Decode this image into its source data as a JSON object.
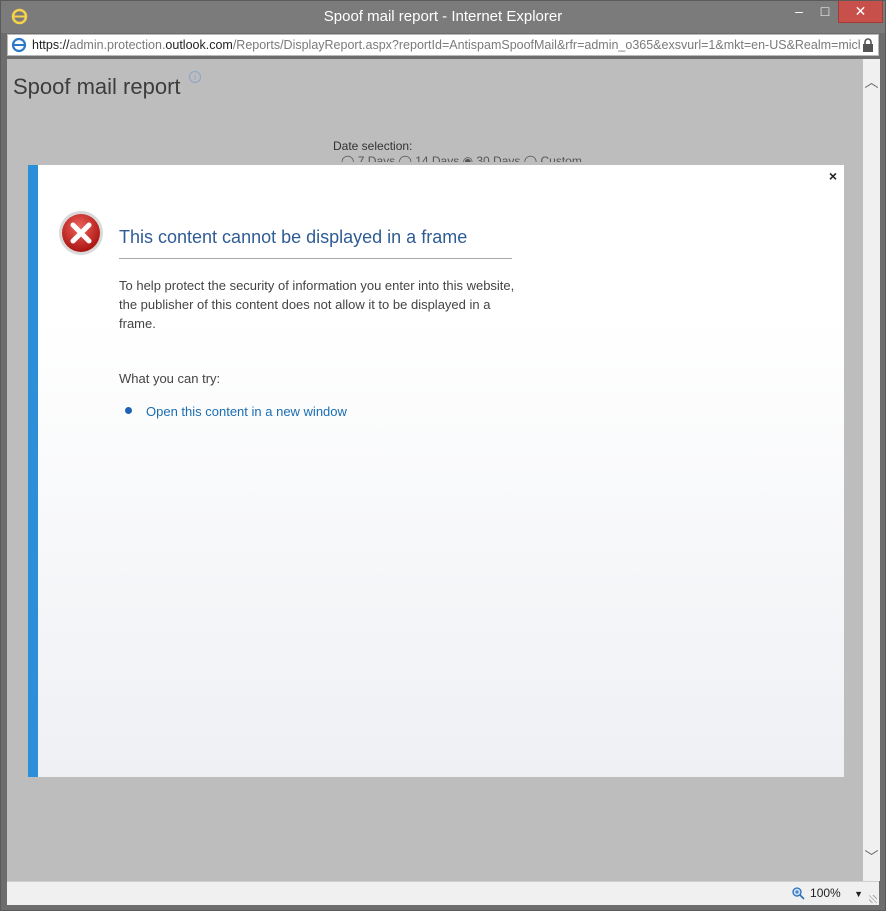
{
  "window": {
    "title": "Spoof mail report - Internet Explorer",
    "controls": {
      "minimize": "–",
      "maximize": "□",
      "close": "✕"
    }
  },
  "address": {
    "scheme": "https://",
    "host_prefix": "admin.protection.",
    "host_main": "outlook.com",
    "path": "/Reports/DisplayReport.aspx?reportId=AntispamSpoofMail&rfr=admin_o365&exsvurl=1&mkt=en-US&Realm=mich"
  },
  "page": {
    "title": "Spoof mail report",
    "info": "i",
    "date_label": "Date selection:",
    "date_options": "◯ 7 Days   ◯ 14 Days   ◉ 30 Days   ◯ Custom"
  },
  "dialog": {
    "close": "×",
    "heading": "This content cannot be displayed in a frame",
    "description": "To help protect the security of information you enter into this website, the publisher of this content does not allow it to be displayed in a frame.",
    "try_label": "What you can try:",
    "link": "Open this content in a new window"
  },
  "statusbar": {
    "zoom": "100%"
  },
  "colors": {
    "accent_blue": "#2d8ed9",
    "heading_blue": "#2f5c94",
    "link_blue": "#1a6eb2",
    "close_red": "#c7504b"
  },
  "icons": [
    "ie-logo-icon",
    "lock-icon",
    "info-icon",
    "error-icon",
    "close-icon",
    "zoom-icon",
    "chevron-up-icon",
    "chevron-down-icon"
  ]
}
